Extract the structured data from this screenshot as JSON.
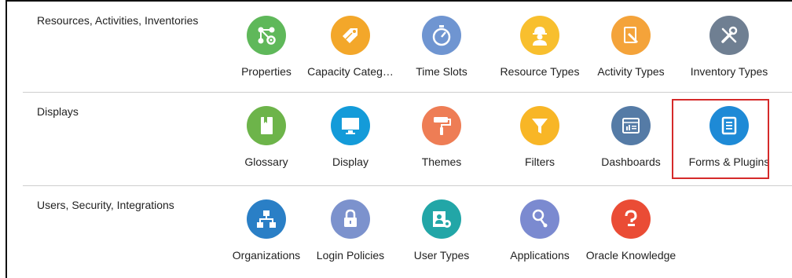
{
  "sections": [
    {
      "title": "Resources, Activities, Inventories",
      "tiles": [
        {
          "label": "Properties",
          "icon": "properties-icon",
          "color": "#5fb85a"
        },
        {
          "label": "Capacity Categ…",
          "icon": "capacity-categories-icon",
          "color": "#f3a72a"
        },
        {
          "label": "Time Slots",
          "icon": "time-slots-icon",
          "color": "#6f95d1"
        },
        {
          "label": "Resource Types",
          "icon": "resource-types-icon",
          "color": "#f8bf2e"
        },
        {
          "label": "Activity Types",
          "icon": "activity-types-icon",
          "color": "#f4a33a"
        },
        {
          "label": "Inventory Types",
          "icon": "inventory-types-icon",
          "color": "#6f7f92"
        }
      ]
    },
    {
      "title": "Displays",
      "tiles": [
        {
          "label": "Glossary",
          "icon": "glossary-icon",
          "color": "#6db44a"
        },
        {
          "label": "Display",
          "icon": "display-icon",
          "color": "#149bd9"
        },
        {
          "label": "Themes",
          "icon": "themes-icon",
          "color": "#ee7d55"
        },
        {
          "label": "Filters",
          "icon": "filters-icon",
          "color": "#f8b626"
        },
        {
          "label": "Dashboards",
          "icon": "dashboards-icon",
          "color": "#557ba6"
        },
        {
          "label": "Forms & Plugins",
          "icon": "forms-plugins-icon",
          "color": "#1e8ad6"
        }
      ]
    },
    {
      "title": "Users, Security, Integrations",
      "tiles": [
        {
          "label": "Organizations",
          "icon": "organizations-icon",
          "color": "#2a7fc6"
        },
        {
          "label": "Login Policies",
          "icon": "login-policies-icon",
          "color": "#7c92cd"
        },
        {
          "label": "User Types",
          "icon": "user-types-icon",
          "color": "#22a6a7"
        },
        {
          "label": "Applications",
          "icon": "applications-icon",
          "color": "#7b8ad0"
        },
        {
          "label": "Oracle Knowledge",
          "icon": "oracle-knowledge-icon",
          "color": "#ea4c35"
        }
      ]
    }
  ],
  "highlighted_tile": "Forms & Plugins"
}
